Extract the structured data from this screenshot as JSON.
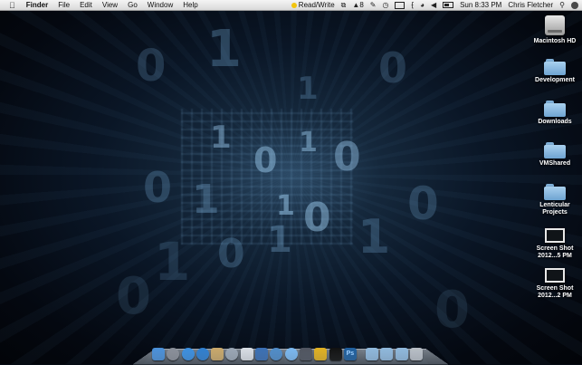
{
  "menubar": {
    "apple_icon": "apple-icon",
    "app_name": "Finder",
    "menus": [
      "File",
      "Edit",
      "View",
      "Go",
      "Window",
      "Help"
    ],
    "status": {
      "read_write": "Read/Write",
      "adobe_count": "8",
      "clock": "Sun 8:33 PM",
      "user": "Chris Fletcher"
    }
  },
  "desktop": {
    "icons": [
      {
        "label": "Macintosh HD",
        "type": "hard-drive-icon"
      },
      {
        "label": "Development",
        "type": "folder-icon"
      },
      {
        "label": "Downloads",
        "type": "folder-icon"
      },
      {
        "label": "VMShared",
        "type": "folder-icon"
      },
      {
        "label": "Lenticular\nProjects",
        "type": "folder-icon"
      },
      {
        "label": "Screen Shot\n2012...5 PM",
        "type": "screenshot-file-icon"
      },
      {
        "label": "Screen Shot\n2012...2 PM",
        "type": "screenshot-file-icon"
      }
    ]
  },
  "dock": {
    "apps": [
      {
        "name": "finder-icon",
        "color": "#4a90d9"
      },
      {
        "name": "launchpad-icon",
        "color": "#8a8f99"
      },
      {
        "name": "safari-icon",
        "color": "#3b8fe0"
      },
      {
        "name": "itunes-icon",
        "color": "#2f7fd0"
      },
      {
        "name": "photo-app-icon",
        "color": "#c9a86a"
      },
      {
        "name": "system-utility-icon",
        "color": "#9aa6b4"
      },
      {
        "name": "preview-icon",
        "color": "#d8dde4"
      },
      {
        "name": "xcode-icon",
        "color": "#3a6fb4"
      },
      {
        "name": "maps-icon",
        "color": "#4f8cc9"
      },
      {
        "name": "messages-icon",
        "color": "#7ab8f0"
      },
      {
        "name": "camera-icon",
        "color": "#505560"
      },
      {
        "name": "lyrics-app-icon",
        "color": "#e0b020"
      },
      {
        "name": "terminal-icon",
        "color": "#111111"
      },
      {
        "name": "photoshop-icon",
        "color": "#1f5f9e"
      },
      {
        "name": "applications-folder-icon",
        "color": "#8fb8dc"
      },
      {
        "name": "documents-folder-icon",
        "color": "#8fb8dc"
      },
      {
        "name": "downloads-folder-icon",
        "color": "#8fb8dc"
      },
      {
        "name": "trash-icon",
        "color": "#b8bec6"
      }
    ],
    "photoshop_label": "Ps"
  }
}
